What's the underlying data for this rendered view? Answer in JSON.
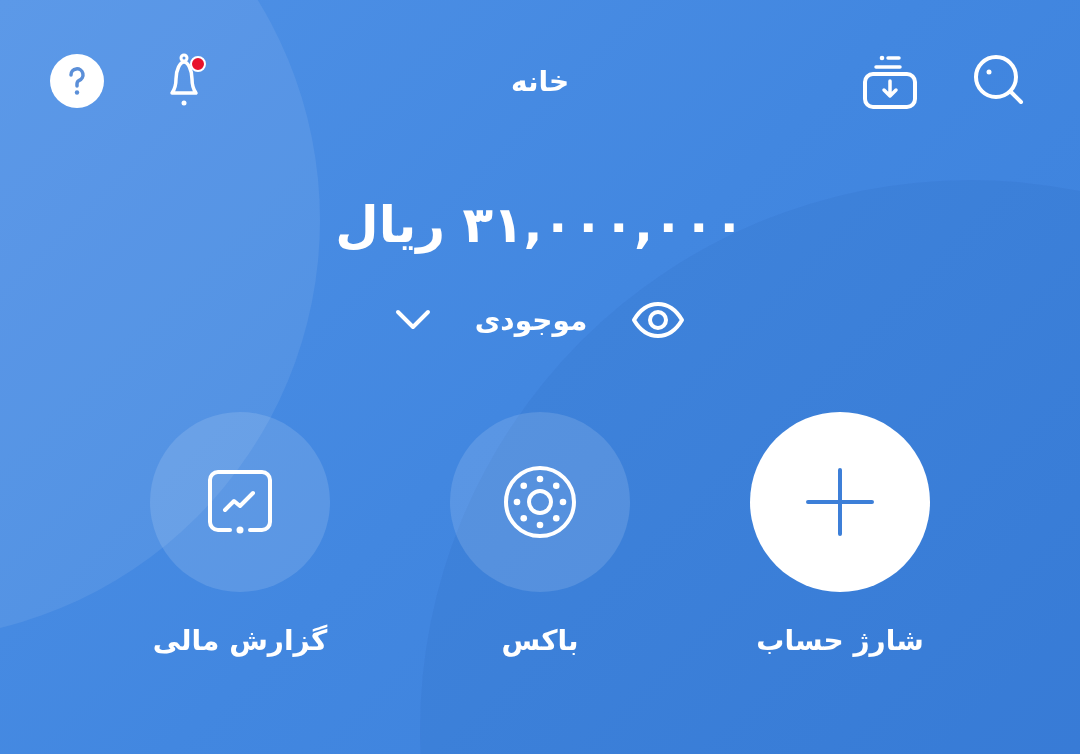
{
  "header": {
    "title": "خانه",
    "notification_dot": true
  },
  "balance": {
    "amount": "۳۱,۰۰۰,۰۰۰ ریال",
    "label": "موجودی"
  },
  "actions": [
    {
      "kind": "charge",
      "label": "شارژ حساب",
      "highlighted": true
    },
    {
      "kind": "box",
      "label": "باکس",
      "highlighted": false
    },
    {
      "kind": "report",
      "label": "گزارش مالی",
      "highlighted": false
    }
  ]
}
